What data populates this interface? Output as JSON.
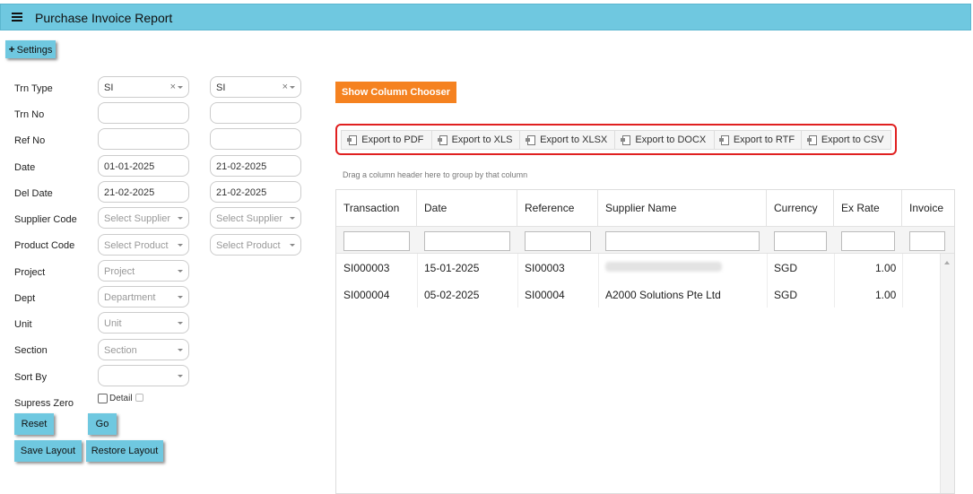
{
  "header": {
    "title": "Purchase Invoice Report",
    "menu_icon": "hamburger-icon"
  },
  "settings_label": "Settings",
  "form": {
    "trn_type_label": "Trn Type",
    "trn_type_from": "SI",
    "trn_type_to": "SI",
    "clear_glyph": "×",
    "trn_no_label": "Trn No",
    "ref_no_label": "Ref No",
    "date_label": "Date",
    "date_from": "01-01-2025",
    "date_to": "21-02-2025",
    "del_date_label": "Del Date",
    "del_date_from": "21-02-2025",
    "del_date_to": "21-02-2025",
    "supplier_code_label": "Supplier Code",
    "supplier_placeholder": "Select Supplier",
    "product_code_label": "Product Code",
    "product_placeholder": "Select Product",
    "project_label": "Project",
    "project_placeholder": "Project",
    "dept_label": "Dept",
    "dept_placeholder": "Department",
    "unit_label": "Unit",
    "unit_placeholder": "Unit",
    "section_label": "Section",
    "section_placeholder": "Section",
    "sort_by_label": "Sort By",
    "supress_zero_label": "Supress Zero",
    "detail_label": "Detail"
  },
  "buttons": {
    "reset": "Reset",
    "go": "Go",
    "save_layout": "Save Layout",
    "restore_layout": "Restore Layout",
    "show_column_chooser": "Show Column Chooser"
  },
  "exports": [
    {
      "label": "Export to PDF"
    },
    {
      "label": "Export to XLS"
    },
    {
      "label": "Export to XLSX"
    },
    {
      "label": "Export to DOCX"
    },
    {
      "label": "Export to RTF"
    },
    {
      "label": "Export to CSV"
    }
  ],
  "group_hint": "Drag a column header here to group by that column",
  "table": {
    "columns": [
      "Transaction",
      "Date",
      "Reference",
      "Supplier Name",
      "Currency",
      "Ex Rate",
      "Invoice"
    ],
    "rows": [
      {
        "transaction": "SI000003",
        "date": "15-01-2025",
        "reference": "SI00003",
        "supplier": "",
        "currency": "SGD",
        "ex_rate": "1.00"
      },
      {
        "transaction": "SI000004",
        "date": "05-02-2025",
        "reference": "SI00004",
        "supplier": "A2000 Solutions Pte Ltd",
        "currency": "SGD",
        "ex_rate": "1.00"
      }
    ]
  },
  "colors": {
    "header_bg": "#6fc8e0",
    "accent_orange": "#f58220",
    "highlight_border": "#e02020"
  }
}
